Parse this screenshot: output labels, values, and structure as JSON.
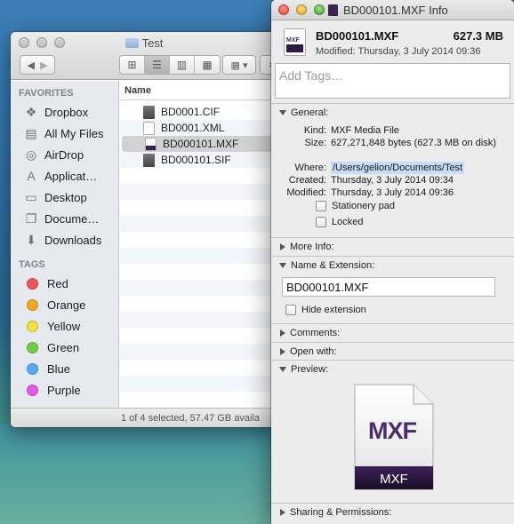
{
  "finder": {
    "title": "Test",
    "column_header": "Name",
    "favorites_heading": "FAVORITES",
    "favorites": [
      {
        "label": "Dropbox",
        "icon": "dropbox-icon"
      },
      {
        "label": "All My Files",
        "icon": "all-my-files-icon"
      },
      {
        "label": "AirDrop",
        "icon": "airdrop-icon"
      },
      {
        "label": "Applicat…",
        "icon": "applications-icon"
      },
      {
        "label": "Desktop",
        "icon": "desktop-icon"
      },
      {
        "label": "Docume…",
        "icon": "documents-icon"
      },
      {
        "label": "Downloads",
        "icon": "downloads-icon"
      }
    ],
    "tags_heading": "TAGS",
    "tags": [
      {
        "label": "Red",
        "color": "#f0555a"
      },
      {
        "label": "Orange",
        "color": "#f5a623"
      },
      {
        "label": "Yellow",
        "color": "#f2e23c"
      },
      {
        "label": "Green",
        "color": "#6cd04a"
      },
      {
        "label": "Blue",
        "color": "#5aa9f0"
      },
      {
        "label": "Purple",
        "color": "#e45ae8"
      }
    ],
    "files": [
      {
        "name": "BD0001.CIF",
        "selected": false
      },
      {
        "name": "BD0001.XML",
        "selected": false
      },
      {
        "name": "BD000101.MXF",
        "selected": true
      },
      {
        "name": "BD000101.SIF",
        "selected": false
      }
    ],
    "status": "1 of 4 selected, 57.47 GB availa"
  },
  "info": {
    "window_title": "BD000101.MXF Info",
    "filename": "BD000101.MXF",
    "size_summary": "627.3 MB",
    "modified_summary": "Modified: Thursday, 3 July 2014 09:36",
    "tags_placeholder": "Add Tags…",
    "general": {
      "heading": "General:",
      "kind_label": "Kind:",
      "kind": "MXF Media File",
      "size_label": "Size:",
      "size": "627,271,848 bytes (627.3 MB on disk)",
      "where_label": "Where:",
      "where": "/Users/gelion/Documents/Test",
      "created_label": "Created:",
      "created": "Thursday, 3 July 2014 09:34",
      "modified_label": "Modified:",
      "modified": "Thursday, 3 July 2014 09:36",
      "stationery_label": "Stationery pad",
      "locked_label": "Locked"
    },
    "more_info": "More Info:",
    "name_extension": {
      "heading": "Name & Extension:",
      "value": "BD000101.MXF",
      "hide_label": "Hide extension"
    },
    "comments": "Comments:",
    "open_with": "Open with:",
    "preview_heading": "Preview:",
    "preview_logo": "MXF",
    "preview_badge": "MXF",
    "sharing": "Sharing & Permissions:"
  }
}
